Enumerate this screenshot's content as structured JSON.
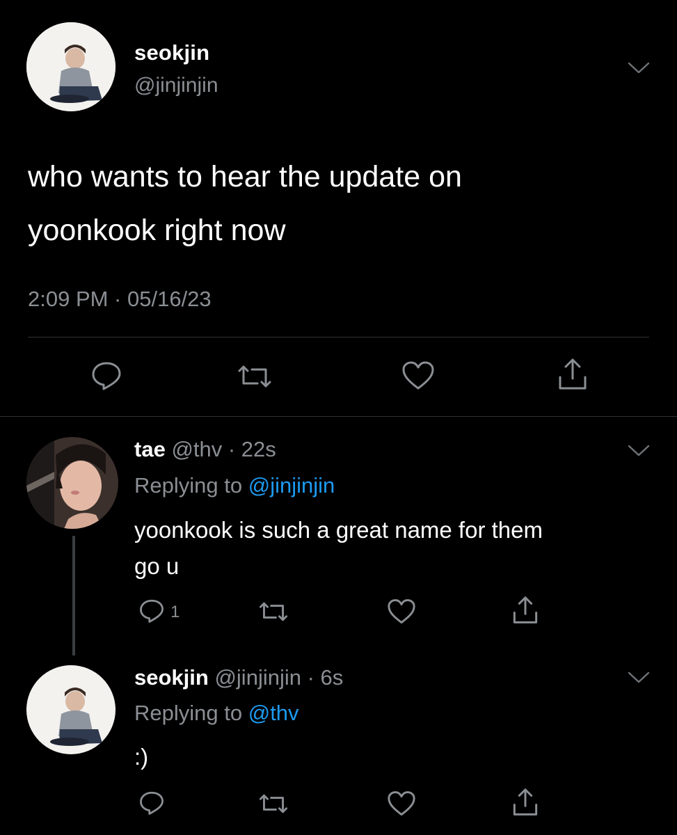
{
  "main_tweet": {
    "display_name": "seokjin",
    "handle": "@jinjinjin",
    "text_line1": "who wants to hear the update on",
    "text_line2": "yoonkook right now",
    "timestamp": "2:09 PM · 05/16/23"
  },
  "replies": [
    {
      "display_name": "tae",
      "handle_time": "@thv · 22s",
      "replying_prefix": "Replying to",
      "replying_to": "@jinjinjin",
      "text_line1": "yoonkook is such a great name for them",
      "text_line2": "go u",
      "reply_count": "1"
    },
    {
      "display_name": "seokjin",
      "handle_time": "@jinjinjin · 6s",
      "replying_prefix": "Replying to",
      "replying_to": "@thv",
      "text_line1": ":)"
    }
  ],
  "icons": {
    "reply": "reply-icon",
    "retweet": "retweet-icon",
    "like": "heart-icon",
    "share": "share-icon",
    "menu": "chevron-down-icon"
  },
  "colors": {
    "background": "#000000",
    "text": "#ffffff",
    "secondary": "#8b8f94",
    "link": "#1d9bf0",
    "divider": "#2f3336"
  }
}
